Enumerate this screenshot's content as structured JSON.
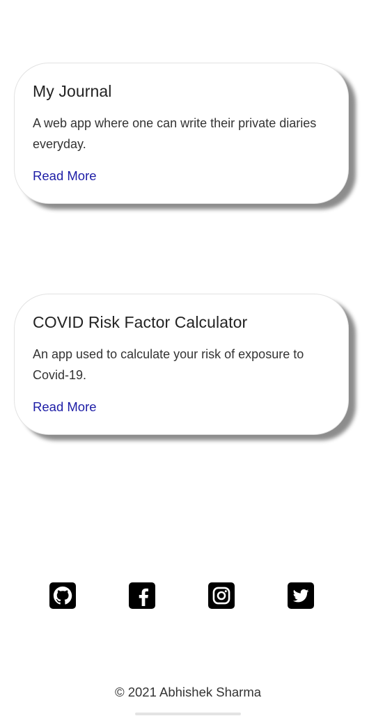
{
  "projects": [
    {
      "title": "My Journal",
      "description": "A web app where one can write their private diaries everyday.",
      "link_label": "Read More"
    },
    {
      "title": "COVID Risk Factor Calculator",
      "description": "An app used to calculate your risk of exposure to Covid-19.",
      "link_label": "Read More"
    }
  ],
  "social_links": [
    {
      "icon": "github-icon"
    },
    {
      "icon": "facebook-icon"
    },
    {
      "icon": "instagram-icon"
    },
    {
      "icon": "twitter-icon"
    }
  ],
  "footer": {
    "copyright": "© 2021 Abhishek Sharma"
  },
  "colors": {
    "link": "#1d1da6",
    "icon_background": "#000000",
    "page_background": "#ffffff"
  }
}
